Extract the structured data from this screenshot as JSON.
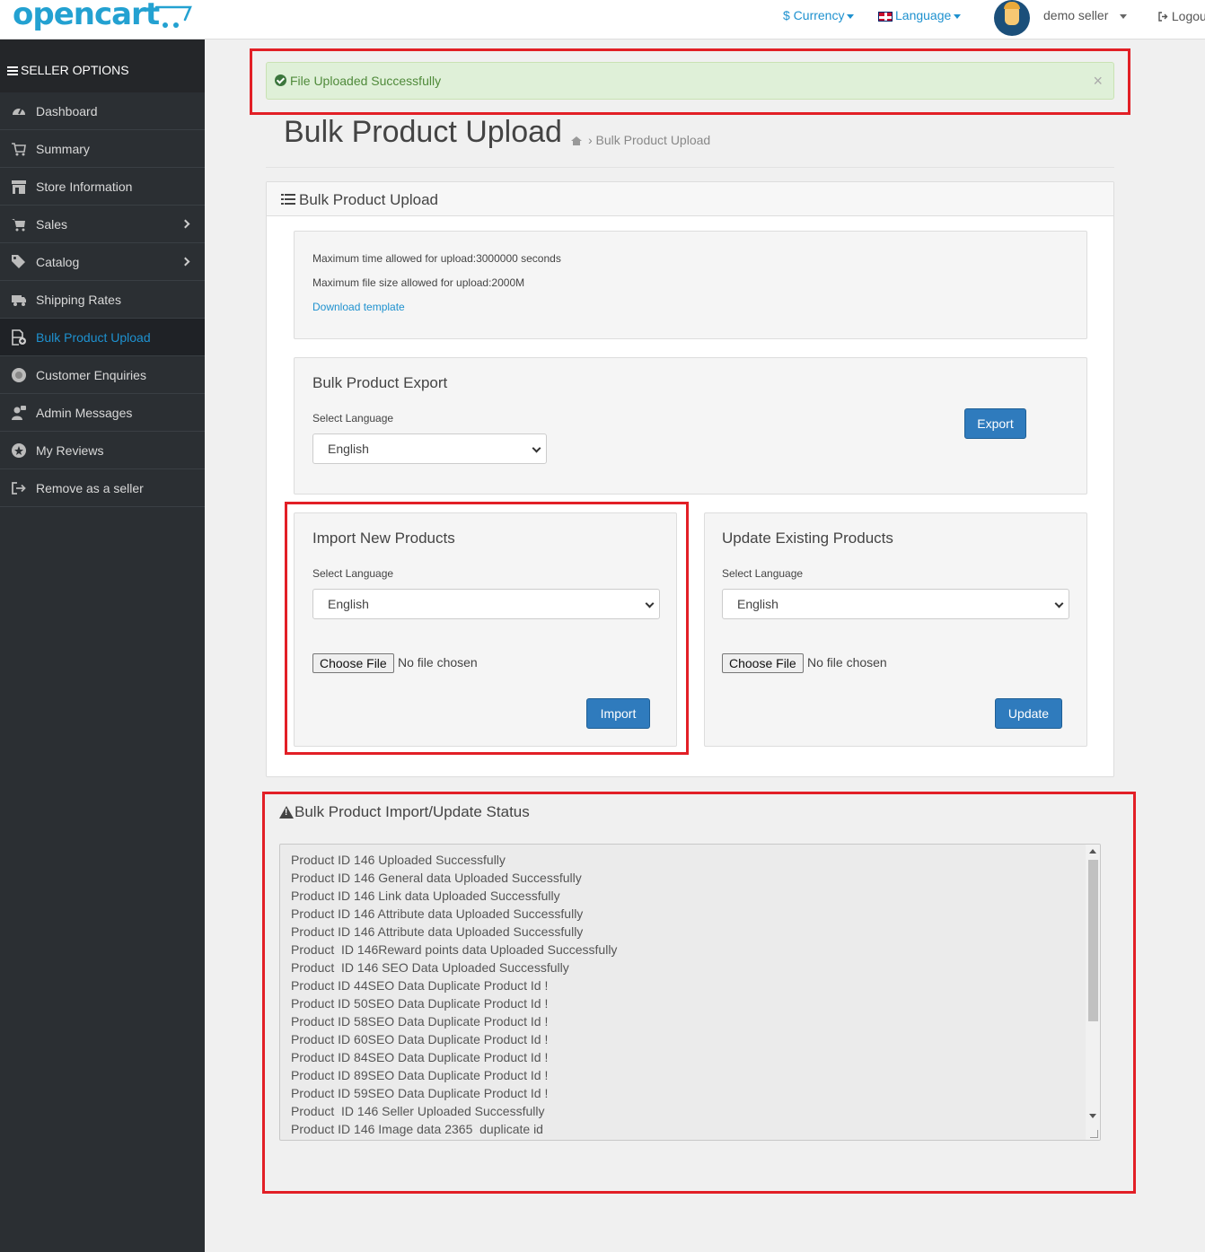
{
  "header": {
    "logo_text": "opencart",
    "currency": "$ Currency",
    "language": "Language",
    "user_name": "demo seller",
    "logout": "Logout"
  },
  "sidebar": {
    "title": "SELLER OPTIONS",
    "items": [
      {
        "label": "Dashboard",
        "icon": "dashboard-icon"
      },
      {
        "label": "Summary",
        "icon": "cart-icon"
      },
      {
        "label": "Store Information",
        "icon": "store-icon"
      },
      {
        "label": "Sales",
        "icon": "cart-icon",
        "has_submenu": true
      },
      {
        "label": "Catalog",
        "icon": "tags-icon",
        "has_submenu": true
      },
      {
        "label": "Shipping Rates",
        "icon": "truck-icon"
      },
      {
        "label": "Bulk Product Upload",
        "icon": "file-upload-icon",
        "active": true
      },
      {
        "label": "Customer Enquiries",
        "icon": "enquiry-icon"
      },
      {
        "label": "Admin Messages",
        "icon": "admin-messages-icon"
      },
      {
        "label": "My Reviews",
        "icon": "reviews-icon"
      },
      {
        "label": "Remove as a seller",
        "icon": "sign-out-icon"
      }
    ]
  },
  "alert": {
    "message": "File Uploaded Successfully",
    "close": "×"
  },
  "page": {
    "title": "Bulk Product Upload",
    "breadcrumb": "› Bulk Product Upload"
  },
  "panel": {
    "heading": "Bulk Product Upload",
    "info": {
      "max_time": "Maximum time allowed for upload:3000000 seconds",
      "max_size": "Maximum file size allowed for upload:2000M",
      "download_link": "Download template"
    },
    "export": {
      "title": "Bulk Product Export",
      "select_label": "Select Language",
      "selected": "English",
      "button": "Export"
    },
    "import": {
      "title": "Import New Products",
      "select_label": "Select Language",
      "selected": "English",
      "file_button": "Choose File",
      "file_status": "No file chosen",
      "button": "Import"
    },
    "update": {
      "title": "Update Existing Products",
      "select_label": "Select Language",
      "selected": "English",
      "file_button": "Choose File",
      "file_status": "No file chosen",
      "button": "Update"
    }
  },
  "status": {
    "title": "Bulk Product Import/Update Status",
    "lines": [
      "Product ID 146 Uploaded Successfully",
      "Product ID 146 General data Uploaded Successfully",
      "Product ID 146 Link data Uploaded Successfully",
      "Product ID 146 Attribute data Uploaded Successfully",
      "Product ID 146 Attribute data Uploaded Successfully",
      "Product  ID 146Reward points data Uploaded Successfully",
      "Product  ID 146 SEO Data Uploaded Successfully",
      "Product ID 44SEO Data Duplicate Product Id !",
      "Product ID 50SEO Data Duplicate Product Id !",
      "Product ID 58SEO Data Duplicate Product Id !",
      "Product ID 60SEO Data Duplicate Product Id !",
      "Product ID 84SEO Data Duplicate Product Id !",
      "Product ID 89SEO Data Duplicate Product Id !",
      "Product ID 59SEO Data Duplicate Product Id !",
      "Product  ID 146 Seller Uploaded Successfully",
      "Product ID 146 Image data 2365  duplicate id"
    ]
  },
  "colors": {
    "accent": "#1e91cf",
    "sidebar_bg": "#2b2f33",
    "button": "#2f7bbd",
    "alert_bg": "#dff0d8",
    "highlight": "#e21f26"
  }
}
